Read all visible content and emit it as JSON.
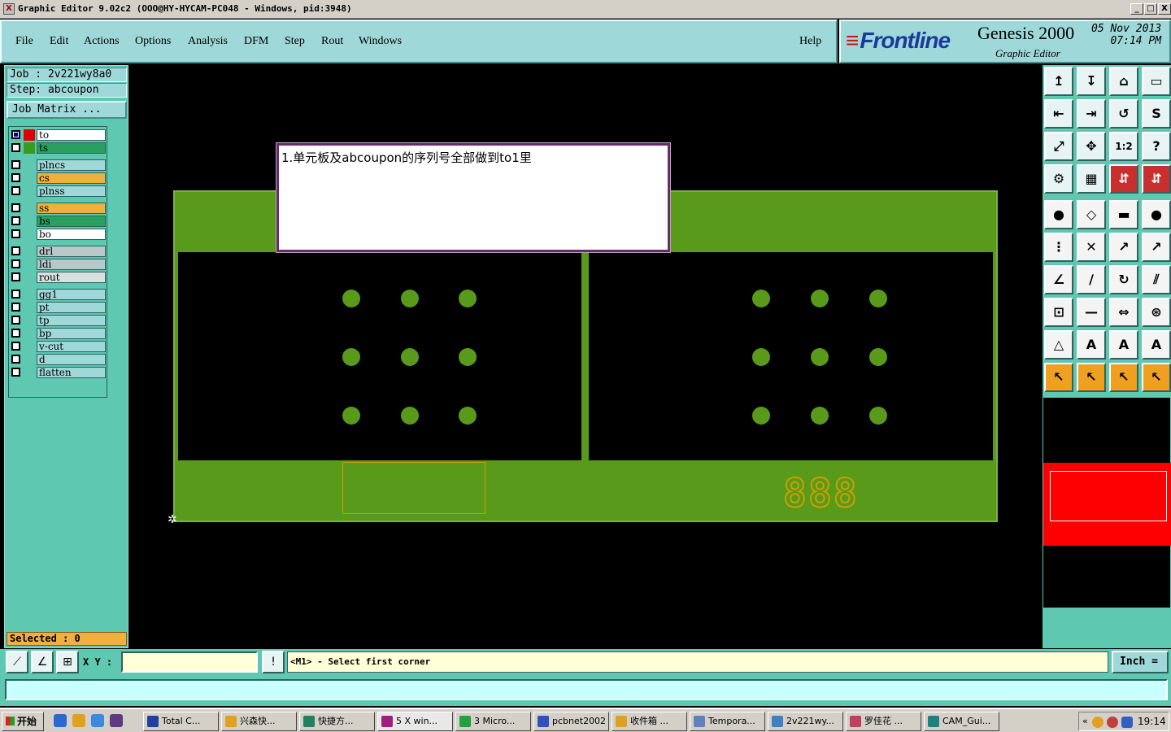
{
  "window": {
    "title": "Graphic Editor 9.02c2  (OOO@HY-HYCAM-PC048 - Windows, pid:3948)",
    "icon": "X",
    "min": "_",
    "max": "□",
    "close": "X"
  },
  "menu": [
    "File",
    "Edit",
    "Actions",
    "Options",
    "Analysis",
    "DFM",
    "Step",
    "Rout",
    "Windows"
  ],
  "help": "Help",
  "brand": {
    "logo": "Frontline",
    "product": "Genesis 2000",
    "subtitle": "Graphic Editor",
    "date": "05 Nov 2013",
    "time": "07:14 PM"
  },
  "job": {
    "job_label": "Job  : 2v221wy8a0",
    "step_label": "Step: abcoupon",
    "matrix_btn": "Job Matrix ..."
  },
  "layers": [
    {
      "name": "to",
      "color": "#ffffff",
      "swatch": "#e00000",
      "checked": true
    },
    {
      "name": "ts",
      "color": "#2aa060",
      "swatch": "#3a9a20",
      "checked": false
    },
    {
      "name": "plncs",
      "color": "#9ed8d8",
      "swatch": "",
      "checked": false
    },
    {
      "name": "cs",
      "color": "#f0b040",
      "swatch": "",
      "checked": false
    },
    {
      "name": "plnss",
      "color": "#9ed8d8",
      "swatch": "",
      "checked": false
    },
    {
      "name": "ss",
      "color": "#f0b040",
      "swatch": "",
      "checked": false
    },
    {
      "name": "bs",
      "color": "#2aa060",
      "swatch": "",
      "checked": false
    },
    {
      "name": "bo",
      "color": "#ffffff",
      "swatch": "",
      "checked": false
    },
    {
      "name": "drl",
      "color": "#b8c8c8",
      "swatch": "",
      "checked": false
    },
    {
      "name": "ldi",
      "color": "#b8c8c8",
      "swatch": "",
      "checked": false
    },
    {
      "name": "rout",
      "color": "#d8e0e0",
      "swatch": "",
      "checked": false
    },
    {
      "name": "gg1",
      "color": "#9ed8d8",
      "swatch": "",
      "checked": false
    },
    {
      "name": "pt",
      "color": "#9ed8d8",
      "swatch": "",
      "checked": false
    },
    {
      "name": "tp",
      "color": "#9ed8d8",
      "swatch": "",
      "checked": false
    },
    {
      "name": "bp",
      "color": "#9ed8d8",
      "swatch": "",
      "checked": false
    },
    {
      "name": "v-cut",
      "color": "#9ed8d8",
      "swatch": "",
      "checked": false
    },
    {
      "name": "d",
      "color": "#9ed8d8",
      "swatch": "",
      "checked": false
    },
    {
      "name": "flatten",
      "color": "#9ed8d8",
      "swatch": "",
      "checked": false
    }
  ],
  "selected": "Selected : 0",
  "note": "1.单元板及abcoupon的序列号全部做到to1里",
  "serial_digits": "888",
  "tools": [
    [
      "↥",
      "↧",
      "⌂",
      "▭"
    ],
    [
      "⇤",
      "⇥",
      "↺",
      "S"
    ],
    [
      "⤢",
      "✥",
      "1:2",
      "?"
    ],
    [
      "⚙",
      "▦",
      "⇵",
      "⇵"
    ],
    [
      "●",
      "◇",
      "▬",
      "●"
    ],
    [
      "⋮",
      "✕",
      "↗",
      "↗"
    ],
    [
      "∠",
      "∕",
      "↻",
      "⫽"
    ],
    [
      "⊡",
      "—",
      "⇔",
      "⊛"
    ],
    [
      "△",
      "A",
      "A",
      "A"
    ],
    [
      "↖",
      "↖",
      "↖",
      "↖"
    ]
  ],
  "command": {
    "xy_label": "X Y :",
    "xy_value": "",
    "bang": "!",
    "prompt": "<M1> - Select first corner",
    "unit": "Inch ="
  },
  "taskbar": {
    "start": "开始",
    "tasks": [
      "Total C...",
      "兴森快...",
      "快捷方...",
      "5 X win...",
      "3 Micro...",
      "pcbnet2002",
      "收件箱 ...",
      "Tempora...",
      "2v221wy...",
      "罗佳花 ...",
      "CAM_Gui..."
    ],
    "clock": "19:14"
  }
}
